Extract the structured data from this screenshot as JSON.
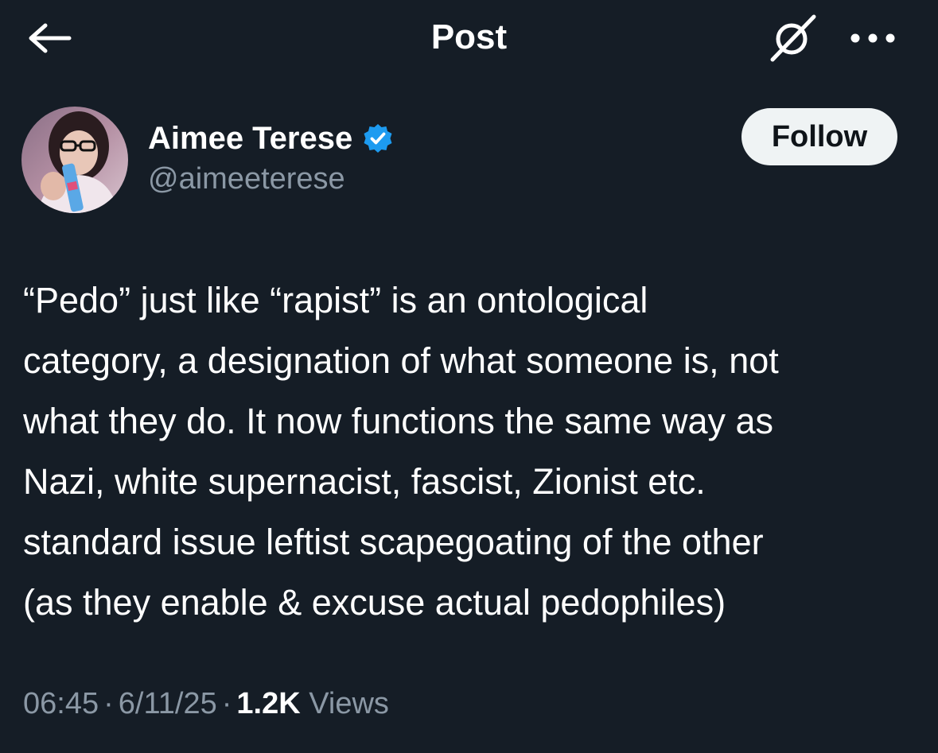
{
  "header": {
    "title": "Post",
    "back_icon": "arrow-left-icon",
    "grok_icon": "grok-icon",
    "more_icon": "more-horizontal-icon"
  },
  "author": {
    "display_name": "Aimee Terese",
    "handle": "@aimeeterese",
    "verified": true,
    "verified_color": "#1d9bf0"
  },
  "follow_label": "Follow",
  "tweet": {
    "text": "“Pedo” just like “rapist” is an ontological\ncategory, a designation of what someone is, not\nwhat they do. It now functions the same way as\nNazi, white supernacist, fascist, Zionist etc.\nstandard  issue leftist scapegoating of the other\n(as they enable & excuse actual pedophiles)"
  },
  "meta": {
    "time": "06:45",
    "date": "6/11/25",
    "views_count": "1.2K",
    "views_label": "Views",
    "separator": "·"
  },
  "colors": {
    "background": "#151d26",
    "text_primary": "#ffffff",
    "text_secondary": "#8b98a5",
    "follow_bg": "#eff3f4"
  }
}
